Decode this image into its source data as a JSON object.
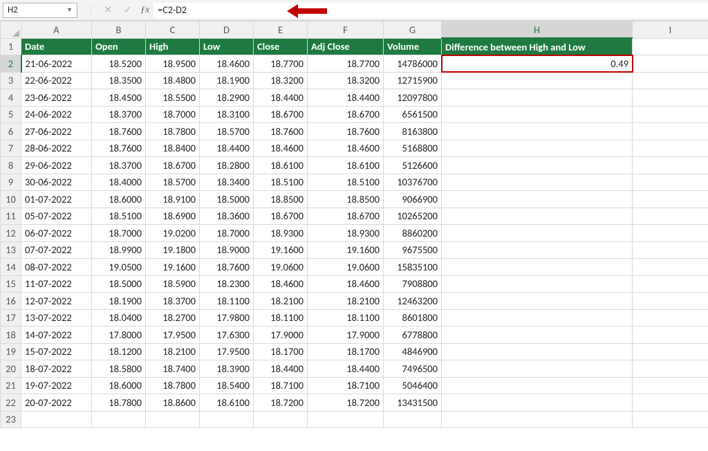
{
  "name_box": "H2",
  "formula": "=C2-D2",
  "col_labels": [
    "A",
    "B",
    "C",
    "D",
    "E",
    "F",
    "G",
    "H",
    "I"
  ],
  "row_labels_extra": [
    23
  ],
  "headers": {
    "A": "Date",
    "B": "Open",
    "C": "High",
    "D": "Low",
    "E": "Close",
    "F": "Adj Close",
    "G": "Volume",
    "H": "Difference between High and Low"
  },
  "active": {
    "row": 2,
    "col": "H",
    "value": "0.49"
  },
  "rows": [
    {
      "r": 2,
      "A": "21-06-2022",
      "B": "18.5200",
      "C": "18.9500",
      "D": "18.4600",
      "E": "18.7700",
      "F": "18.7700",
      "G": "14786000"
    },
    {
      "r": 3,
      "A": "22-06-2022",
      "B": "18.3500",
      "C": "18.4800",
      "D": "18.1900",
      "E": "18.3200",
      "F": "18.3200",
      "G": "12715900"
    },
    {
      "r": 4,
      "A": "23-06-2022",
      "B": "18.4500",
      "C": "18.5500",
      "D": "18.2900",
      "E": "18.4400",
      "F": "18.4400",
      "G": "12097800"
    },
    {
      "r": 5,
      "A": "24-06-2022",
      "B": "18.3700",
      "C": "18.7000",
      "D": "18.3100",
      "E": "18.6700",
      "F": "18.6700",
      "G": "6561500"
    },
    {
      "r": 6,
      "A": "27-06-2022",
      "B": "18.7600",
      "C": "18.7800",
      "D": "18.5700",
      "E": "18.7600",
      "F": "18.7600",
      "G": "8163800"
    },
    {
      "r": 7,
      "A": "28-06-2022",
      "B": "18.7600",
      "C": "18.8400",
      "D": "18.4400",
      "E": "18.4600",
      "F": "18.4600",
      "G": "5168800"
    },
    {
      "r": 8,
      "A": "29-06-2022",
      "B": "18.3700",
      "C": "18.6700",
      "D": "18.2800",
      "E": "18.6100",
      "F": "18.6100",
      "G": "5126600"
    },
    {
      "r": 9,
      "A": "30-06-2022",
      "B": "18.4000",
      "C": "18.5700",
      "D": "18.3400",
      "E": "18.5100",
      "F": "18.5100",
      "G": "10376700"
    },
    {
      "r": 10,
      "A": "01-07-2022",
      "B": "18.6000",
      "C": "18.9100",
      "D": "18.5000",
      "E": "18.8500",
      "F": "18.8500",
      "G": "9066900"
    },
    {
      "r": 11,
      "A": "05-07-2022",
      "B": "18.5100",
      "C": "18.6900",
      "D": "18.3600",
      "E": "18.6700",
      "F": "18.6700",
      "G": "10265200"
    },
    {
      "r": 12,
      "A": "06-07-2022",
      "B": "18.7000",
      "C": "19.0200",
      "D": "18.7000",
      "E": "18.9300",
      "F": "18.9300",
      "G": "8860200"
    },
    {
      "r": 13,
      "A": "07-07-2022",
      "B": "18.9900",
      "C": "19.1800",
      "D": "18.9000",
      "E": "19.1600",
      "F": "19.1600",
      "G": "9675500"
    },
    {
      "r": 14,
      "A": "08-07-2022",
      "B": "19.0500",
      "C": "19.1600",
      "D": "18.7600",
      "E": "19.0600",
      "F": "19.0600",
      "G": "15835100"
    },
    {
      "r": 15,
      "A": "11-07-2022",
      "B": "18.5000",
      "C": "18.5900",
      "D": "18.2300",
      "E": "18.4600",
      "F": "18.4600",
      "G": "7908800"
    },
    {
      "r": 16,
      "A": "12-07-2022",
      "B": "18.1900",
      "C": "18.3700",
      "D": "18.1100",
      "E": "18.2100",
      "F": "18.2100",
      "G": "12463200"
    },
    {
      "r": 17,
      "A": "13-07-2022",
      "B": "18.0400",
      "C": "18.2700",
      "D": "17.9800",
      "E": "18.1100",
      "F": "18.1100",
      "G": "8601800"
    },
    {
      "r": 18,
      "A": "14-07-2022",
      "B": "17.8000",
      "C": "17.9500",
      "D": "17.6300",
      "E": "17.9000",
      "F": "17.9000",
      "G": "6778800"
    },
    {
      "r": 19,
      "A": "15-07-2022",
      "B": "18.1200",
      "C": "18.2100",
      "D": "17.9500",
      "E": "18.1700",
      "F": "18.1700",
      "G": "4846900"
    },
    {
      "r": 20,
      "A": "18-07-2022",
      "B": "18.5800",
      "C": "18.7400",
      "D": "18.3900",
      "E": "18.4400",
      "F": "18.4400",
      "G": "7496500"
    },
    {
      "r": 21,
      "A": "19-07-2022",
      "B": "18.6000",
      "C": "18.7800",
      "D": "18.5400",
      "E": "18.7100",
      "F": "18.7100",
      "G": "5046400"
    },
    {
      "r": 22,
      "A": "20-07-2022",
      "B": "18.7800",
      "C": "18.8600",
      "D": "18.6100",
      "E": "18.7200",
      "F": "18.7200",
      "G": "13431500"
    }
  ]
}
